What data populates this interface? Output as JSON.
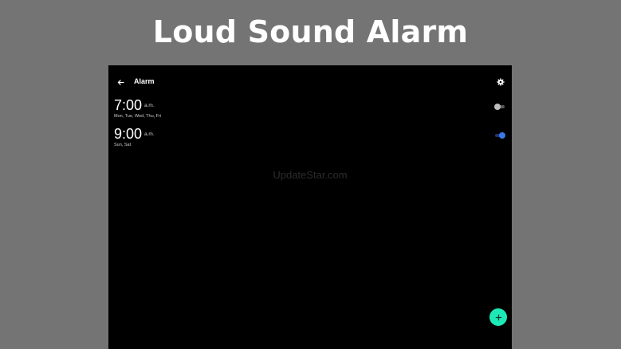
{
  "banner": {
    "title": "Loud Sound Alarm"
  },
  "appbar": {
    "back_icon": "arrow-left-icon",
    "title": "Alarm",
    "settings_icon": "gear-icon"
  },
  "alarms": [
    {
      "time": "7:00",
      "ampm": "a.m.",
      "days": "Mon, Tue, Wed, Thu, Fri",
      "enabled": false
    },
    {
      "time": "9:00",
      "ampm": "a.m.",
      "days": "Sun, Sat",
      "enabled": true
    }
  ],
  "watermark": "UpdateStar.com",
  "fab": {
    "icon": "plus-icon"
  },
  "colors": {
    "banner_background": "#747474",
    "screen_background": "#000000",
    "accent": "#1de9b6",
    "toggle_on": "#3b78e7",
    "toggle_off_thumb": "#bdbdbd"
  }
}
